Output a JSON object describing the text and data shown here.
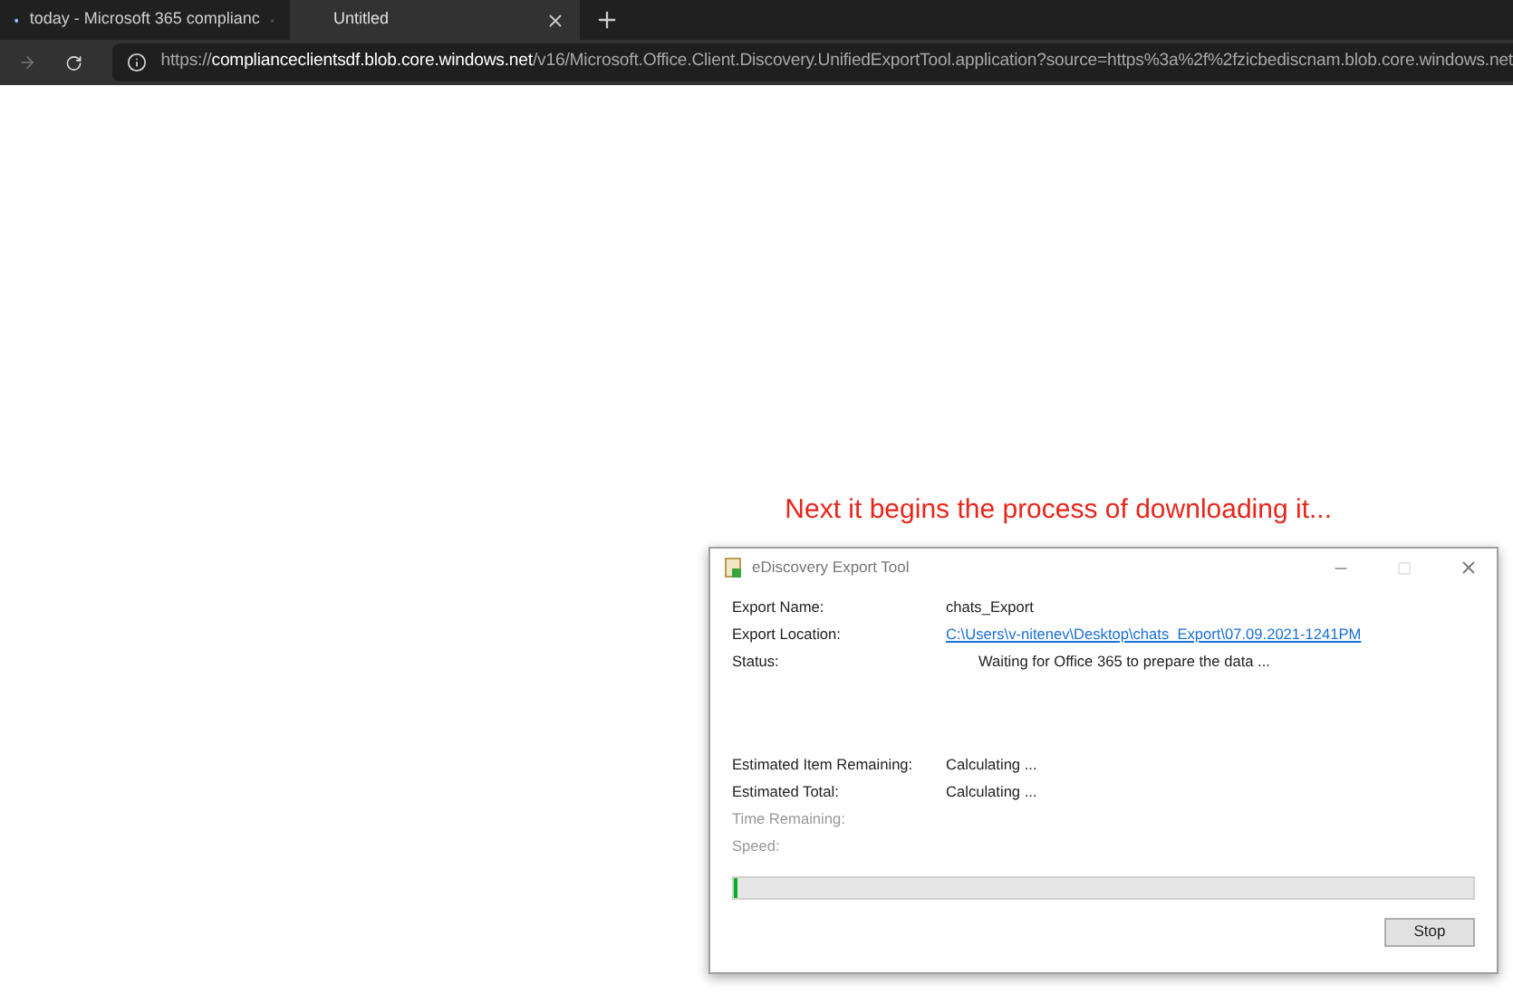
{
  "browser": {
    "tabs": [
      {
        "title": "today - Microsoft 365 complianc",
        "selected": false
      },
      {
        "title": "Untitled",
        "selected": true
      }
    ],
    "address": "https://**complianceclientsdf.blob.core.windows.net**/v16/Microsoft.Office.Client.Discovery.UnifiedExportTool.application?source=https%3a%2f%2fzicbediscnam.blob.core.windows.net"
  },
  "annotation": "Next it begins the process of downloading it...",
  "dialog": {
    "title": "eDiscovery Export Tool",
    "top_rows": [
      {
        "label": "Export Name:",
        "value": "chats_Export",
        "kind": "text"
      },
      {
        "label": "Export Location:",
        "value": "C:\\Users\\v-nitenev\\Desktop\\chats_Export\\07.09.2021-1241PM",
        "kind": "link"
      },
      {
        "label": "Status:",
        "value": "Waiting for Office 365 to prepare the data ...",
        "kind": "status"
      }
    ],
    "bottom_rows": [
      {
        "label": "Estimated Item Remaining:",
        "value": "Calculating ...",
        "disabled": false
      },
      {
        "label": "Estimated Total:",
        "value": "Calculating ...",
        "disabled": false
      },
      {
        "label": "Time Remaining:",
        "disabled": true
      },
      {
        "label": "Speed:",
        "disabled": true
      }
    ],
    "progress": {
      "level": 0.005
    },
    "button": "Stop"
  }
}
